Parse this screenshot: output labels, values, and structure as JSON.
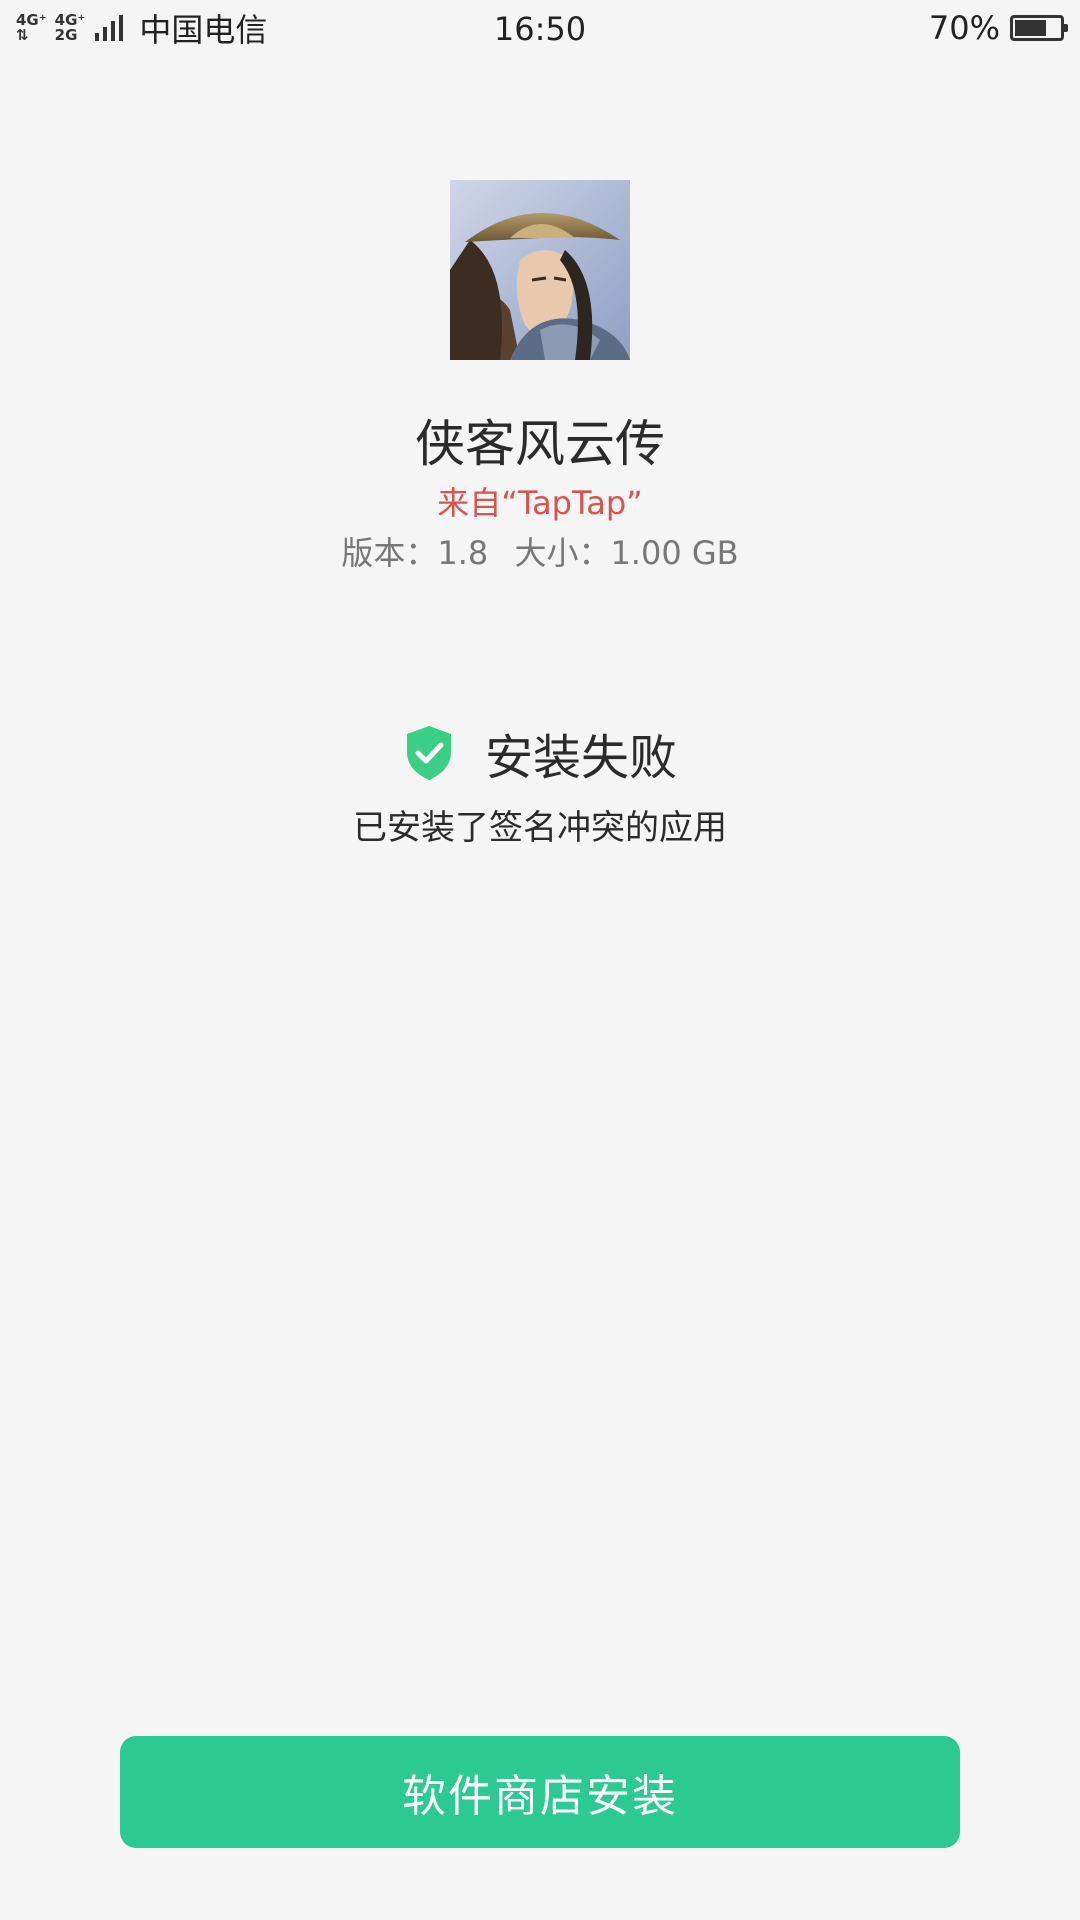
{
  "status_bar": {
    "network_top_left": "4G⁺",
    "network_bottom_left": "⇅",
    "network_top_right": "4G⁺",
    "network_bottom_right": "2G",
    "carrier": "中国电信",
    "time": "16:50",
    "battery_percent": "70%",
    "battery_level": 0.7
  },
  "app": {
    "icon": "game-character-icon",
    "name": "侠客风云传",
    "source": "来自“TapTap”",
    "version": "版本：1.8",
    "size": "大小：1.00 GB"
  },
  "result": {
    "icon": "shield-check-icon",
    "status": "安装失败",
    "detail": "已安装了签名冲突的应用"
  },
  "actions": {
    "store_install_label": "软件商店安装"
  },
  "colors": {
    "accent_green": "#2cc993",
    "shield_green": "#3bcf86",
    "source_red": "#d9534f",
    "background": "#f5f5f5"
  }
}
